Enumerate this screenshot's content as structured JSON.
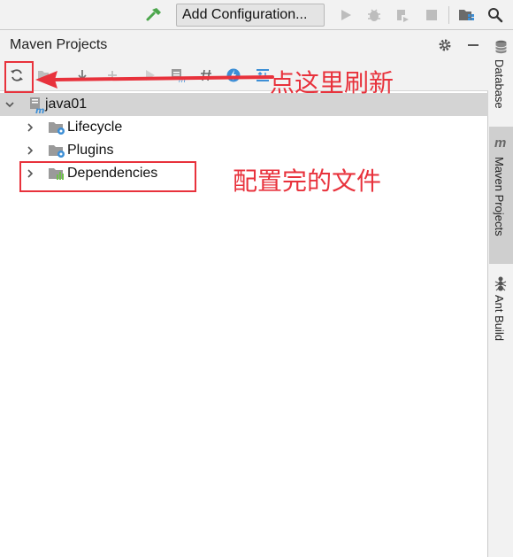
{
  "toolbar": {
    "run_config_label": "Add Configuration..."
  },
  "panel": {
    "title": "Maven Projects"
  },
  "tree": {
    "project": "java01",
    "items": [
      {
        "label": "Lifecycle"
      },
      {
        "label": "Plugins"
      },
      {
        "label": "Dependencies"
      }
    ]
  },
  "stripe": {
    "database": "Database",
    "maven": "Maven Projects",
    "ant": "Ant Build"
  },
  "annotations": {
    "refresh_hint": "点这里刷新",
    "config_hint": "配置完的文件"
  },
  "colors": {
    "annotation": "#e8323c",
    "build_hammer": "#4ca64c",
    "maven_blue": "#3d8fd6",
    "selection": "#d4d4d4"
  }
}
